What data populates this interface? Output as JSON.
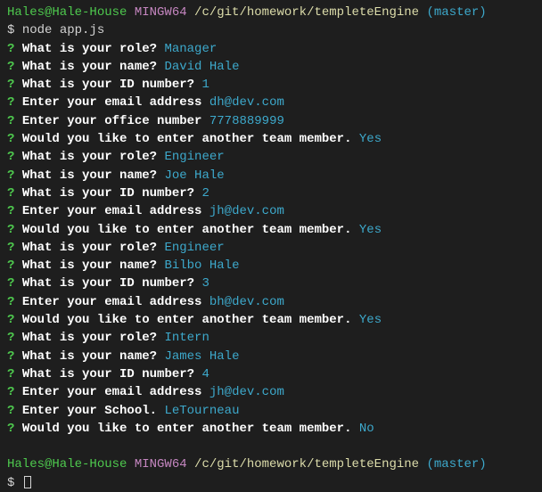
{
  "ps1": {
    "user": "Hales@Hale-House",
    "env": "MINGW64",
    "path": "/c/git/homework/templeteEngine",
    "branch": "(master)"
  },
  "command": "node app.js",
  "dollar": "$",
  "qmark": "?",
  "prompts": [
    {
      "q": "What is your role?",
      "a": "Manager"
    },
    {
      "q": "What is your name?",
      "a": "David Hale"
    },
    {
      "q": "What is your ID number?",
      "a": "1"
    },
    {
      "q": "Enter your email address",
      "a": "dh@dev.com"
    },
    {
      "q": "Enter your office number",
      "a": "7778889999"
    },
    {
      "q": "Would you like to enter another team member.",
      "a": "Yes"
    },
    {
      "q": "What is your role?",
      "a": "Engineer"
    },
    {
      "q": "What is your name?",
      "a": "Joe Hale"
    },
    {
      "q": "What is your ID number?",
      "a": "2"
    },
    {
      "q": "Enter your email address",
      "a": "jh@dev.com"
    },
    {
      "q": "Would you like to enter another team member.",
      "a": "Yes"
    },
    {
      "q": "What is your role?",
      "a": "Engineer"
    },
    {
      "q": "What is your name?",
      "a": "Bilbo Hale"
    },
    {
      "q": "What is your ID number?",
      "a": "3"
    },
    {
      "q": "Enter your email address",
      "a": "bh@dev.com"
    },
    {
      "q": "Would you like to enter another team member.",
      "a": "Yes"
    },
    {
      "q": "What is your role?",
      "a": "Intern"
    },
    {
      "q": "What is your name?",
      "a": "James Hale"
    },
    {
      "q": "What is your ID number?",
      "a": "4"
    },
    {
      "q": "Enter your email address",
      "a": "jh@dev.com"
    },
    {
      "q": "Enter your School.",
      "a": "LeTourneau"
    },
    {
      "q": "Would you like to enter another team member.",
      "a": "No"
    }
  ]
}
